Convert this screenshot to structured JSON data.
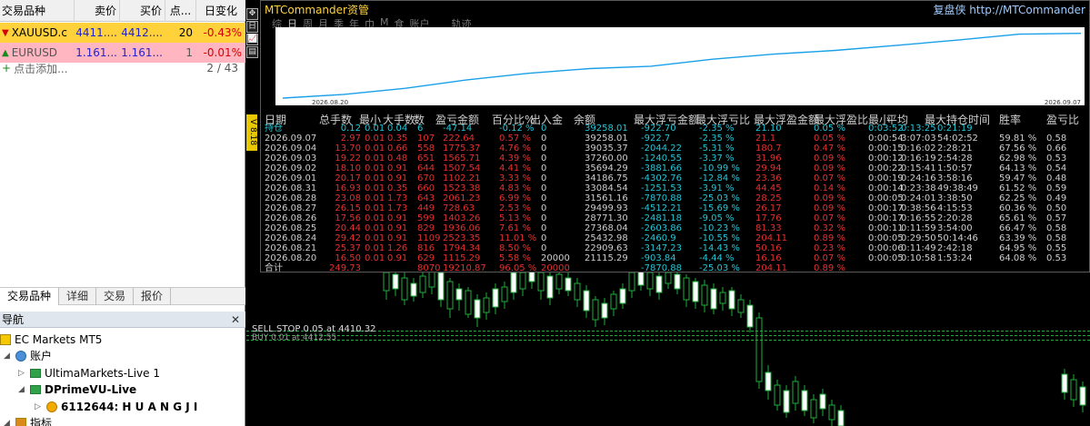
{
  "market_watch": {
    "headers": [
      "交易品种",
      "卖价",
      "买价",
      "点...",
      "日变化"
    ],
    "rows": [
      {
        "symbol": "XAUUSD.c",
        "bid": "4411....",
        "ask": "4412....",
        "spread": "20",
        "change": "-0.43%"
      },
      {
        "symbol": "EURUSD",
        "bid": "1.161...",
        "ask": "1.161...",
        "spread": "1",
        "change": "-0.01%"
      }
    ],
    "add_label": "点击添加...",
    "count": "2 / 43",
    "tabs": [
      "交易品种",
      "详细",
      "交易",
      "报价"
    ]
  },
  "navigator": {
    "title": "导航",
    "close": "✕",
    "items": [
      {
        "label": "EC Markets MT5"
      },
      {
        "label": "账户"
      },
      {
        "label": "UltimaMarkets-Live 1"
      },
      {
        "label": "DPrimeVU-Live"
      },
      {
        "label": "6112644: H U A N G J I"
      },
      {
        "label": "指标"
      }
    ]
  },
  "chart": {
    "toolbar_icons": [
      "crosshair-icon",
      "text-icon",
      "chart-icon",
      "list-icon"
    ],
    "toolbar_glyphs": [
      "✥",
      "日",
      "📈",
      "▤"
    ],
    "v_label": "V 8.18",
    "sl_label": "SELL STOP 0.05 at 4410.32",
    "sl_label2": "BUY 0.01 at 4412.55"
  },
  "mtc": {
    "title": "MTCommander资管",
    "link": "复盘侠 http://MTCommander",
    "tabs": [
      "综",
      "日",
      "周",
      "月",
      "季",
      "年",
      "巾",
      "M",
      "食",
      "账户",
      "轨迹"
    ],
    "active_tab": 1,
    "equity_start_date": "2026.08.20",
    "equity_end_date": "2026.09.07",
    "columns": [
      "日期",
      "总手数",
      "最小",
      "大手数",
      "数",
      "盈亏金额",
      "百分比%",
      "出入金",
      "余额",
      "最大浮亏金额",
      "最大浮亏比",
      "最大浮盈金额",
      "最大浮盈比",
      "最小",
      "平均",
      "最大持仓时间",
      "胜率",
      "盈亏比"
    ],
    "rows": [
      {
        "date": "持仓",
        "tot": "0.12",
        "min": "0.01",
        "max": "0.04",
        "cnt": "6",
        "pl": "-47.14",
        "pct": "-0.12 %",
        "dep": "0",
        "bal": "39258.01",
        "fl": "-922.70",
        "flp": "-2.35 %",
        "fp": "21.10",
        "fpp": "0.05 %",
        "t1": "0:03:52",
        "t2": "0:13:25",
        "t3": "0:21:19",
        "win": "",
        "pr": ""
      },
      {
        "date": "2026.09.07",
        "tot": "2.97",
        "min": "0.01",
        "max": "0.35",
        "cnt": "107",
        "pl": "222.64",
        "pct": "0.57 %",
        "dep": "0",
        "bal": "39258.01",
        "fl": "-922.7",
        "flp": "-2.35 %",
        "fp": "21.1",
        "fpp": "0.05 %",
        "t1": "0:00:54",
        "t2": "3:07:03",
        "t3": "54:02:52",
        "win": "59.81 %",
        "pr": "0.58"
      },
      {
        "date": "2026.09.04",
        "tot": "13.70",
        "min": "0.01",
        "max": "0.66",
        "cnt": "558",
        "pl": "1775.37",
        "pct": "4.76 %",
        "dep": "0",
        "bal": "39035.37",
        "fl": "-2044.22",
        "flp": "-5.31 %",
        "fp": "180.7",
        "fpp": "0.47 %",
        "t1": "0:00:15",
        "t2": "0:16:02",
        "t3": "2:28:21",
        "win": "67.56 %",
        "pr": "0.66"
      },
      {
        "date": "2026.09.03",
        "tot": "19.22",
        "min": "0.01",
        "max": "0.48",
        "cnt": "651",
        "pl": "1565.71",
        "pct": "4.39 %",
        "dep": "0",
        "bal": "37260.00",
        "fl": "-1240.55",
        "flp": "-3.37 %",
        "fp": "31.96",
        "fpp": "0.09 %",
        "t1": "0:00:12",
        "t2": "0:16:19",
        "t3": "2:54:28",
        "win": "62.98 %",
        "pr": "0.53"
      },
      {
        "date": "2026.09.02",
        "tot": "18.10",
        "min": "0.01",
        "max": "0.91",
        "cnt": "644",
        "pl": "1507.54",
        "pct": "4.41 %",
        "dep": "0",
        "bal": "35694.29",
        "fl": "-3881.66",
        "flp": "-10.99 %",
        "fp": "29.94",
        "fpp": "0.09 %",
        "t1": "0:00:22",
        "t2": "0:15:41",
        "t3": "1:50:57",
        "win": "64.13 %",
        "pr": "0.54"
      },
      {
        "date": "2026.09.01",
        "tot": "20.17",
        "min": "0.01",
        "max": "0.91",
        "cnt": "670",
        "pl": "1102.21",
        "pct": "3.33 %",
        "dep": "0",
        "bal": "34186.75",
        "fl": "-4302.76",
        "flp": "-12.84 %",
        "fp": "23.36",
        "fpp": "0.07 %",
        "t1": "0:00:19",
        "t2": "0:24:16",
        "t3": "3:58:16",
        "win": "59.47 %",
        "pr": "0.48"
      },
      {
        "date": "2026.08.31",
        "tot": "16.93",
        "min": "0.01",
        "max": "0.35",
        "cnt": "660",
        "pl": "1523.38",
        "pct": "4.83 %",
        "dep": "0",
        "bal": "33084.54",
        "fl": "-1251.53",
        "flp": "-3.91 %",
        "fp": "44.45",
        "fpp": "0.14 %",
        "t1": "0:00:14",
        "t2": "0:23:38",
        "t3": "49:38:49",
        "win": "61.52 %",
        "pr": "0.59"
      },
      {
        "date": "2026.08.28",
        "tot": "23.08",
        "min": "0.01",
        "max": "1.73",
        "cnt": "643",
        "pl": "2061.23",
        "pct": "6.99 %",
        "dep": "0",
        "bal": "31561.16",
        "fl": "-7870.88",
        "flp": "-25.03 %",
        "fp": "28.25",
        "fpp": "0.09 %",
        "t1": "0:00:05",
        "t2": "0:24:01",
        "t3": "3:38:50",
        "win": "62.25 %",
        "pr": "0.49"
      },
      {
        "date": "2026.08.27",
        "tot": "26.15",
        "min": "0.01",
        "max": "1.73",
        "cnt": "449",
        "pl": "728.63",
        "pct": "2.53 %",
        "dep": "0",
        "bal": "29499.93",
        "fl": "-4512.21",
        "flp": "-15.69 %",
        "fp": "26.17",
        "fpp": "0.09 %",
        "t1": "0:00:17",
        "t2": "0:38:56",
        "t3": "4:15:53",
        "win": "60.36 %",
        "pr": "0.50"
      },
      {
        "date": "2026.08.26",
        "tot": "17.56",
        "min": "0.01",
        "max": "0.91",
        "cnt": "599",
        "pl": "1403.26",
        "pct": "5.13 %",
        "dep": "0",
        "bal": "28771.30",
        "fl": "-2481.18",
        "flp": "-9.05 %",
        "fp": "17.76",
        "fpp": "0.07 %",
        "t1": "0:00:17",
        "t2": "0:16:55",
        "t3": "2:20:28",
        "win": "65.61 %",
        "pr": "0.57"
      },
      {
        "date": "2026.08.25",
        "tot": "20.44",
        "min": "0.01",
        "max": "0.91",
        "cnt": "829",
        "pl": "1936.06",
        "pct": "7.61 %",
        "dep": "0",
        "bal": "27368.04",
        "fl": "-2603.86",
        "flp": "-10.23 %",
        "fp": "81.33",
        "fpp": "0.32 %",
        "t1": "0:00:11",
        "t2": "0:11:59",
        "t3": "3:54:00",
        "win": "66.47 %",
        "pr": "0.58"
      },
      {
        "date": "2026.08.24",
        "tot": "29.42",
        "min": "0.01",
        "max": "0.91",
        "cnt": "1109",
        "pl": "2523.35",
        "pct": "11.01 %",
        "dep": "0",
        "bal": "25432.98",
        "fl": "-2460.9",
        "flp": "-10.55 %",
        "fp": "204.11",
        "fpp": "0.89 %",
        "t1": "0:00:05",
        "t2": "0:29:50",
        "t3": "50:14:46",
        "win": "63.39 %",
        "pr": "0.58"
      },
      {
        "date": "2026.08.21",
        "tot": "25.37",
        "min": "0.01",
        "max": "1.26",
        "cnt": "816",
        "pl": "1794.34",
        "pct": "8.50 %",
        "dep": "0",
        "bal": "22909.63",
        "fl": "-3147.23",
        "flp": "-14.43 %",
        "fp": "50.16",
        "fpp": "0.23 %",
        "t1": "0:00:06",
        "t2": "0:11:49",
        "t3": "2:42:18",
        "win": "64.95 %",
        "pr": "0.55"
      },
      {
        "date": "2026.08.20",
        "tot": "16.50",
        "min": "0.01",
        "max": "0.91",
        "cnt": "629",
        "pl": "1115.29",
        "pct": "5.58 %",
        "dep": "20000",
        "bal": "21115.29",
        "fl": "-903.84",
        "flp": "-4.44 %",
        "fp": "16.16",
        "fpp": "0.07 %",
        "t1": "0:00:05",
        "t2": "0:10:58",
        "t3": "1:53:24",
        "win": "64.08 %",
        "pr": "0.53"
      },
      {
        "date": "合计",
        "tot": "249.73",
        "min": "",
        "max": "",
        "cnt": "8070",
        "pl": "19210.87",
        "pct": "96.05 %",
        "dep": "20000",
        "bal": "",
        "fl": "-7870.88",
        "flp": "-25.03 %",
        "fp": "204.11",
        "fpp": "0.89 %",
        "t1": "",
        "t2": "",
        "t3": "",
        "win": "",
        "pr": ""
      }
    ]
  },
  "colors": {
    "gold": "#ffd23c",
    "pink": "#ffb6c1",
    "down": "#e53030",
    "cyan": "#21c8d8",
    "equity": "#1aa0e8",
    "green": "#1fae3a"
  }
}
